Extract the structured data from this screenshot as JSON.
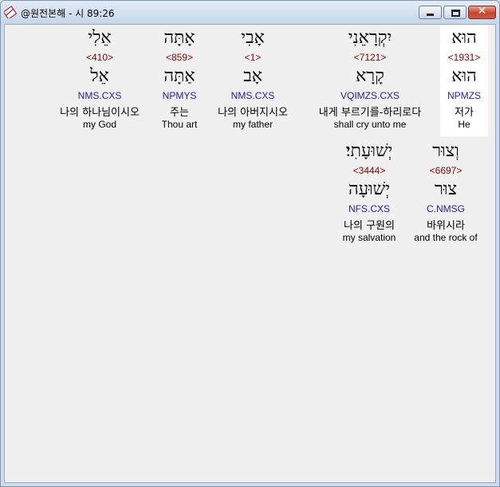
{
  "window": {
    "title": "@원전본해 - 시 89:26",
    "icon": "app-icon",
    "controls": {
      "minimize_icon": "minimize-icon",
      "maximize_icon": "maximize-icon",
      "close_icon": "close-icon"
    }
  },
  "line1": [
    {
      "hebrew": "הוּא",
      "strong": "<1931>",
      "lemma": "הוּא",
      "parsing": "NPMZS",
      "korean": "저가",
      "english": "He",
      "highlighted": true
    },
    {
      "hebrew": "יִקְרָאֵנִי",
      "strong": "<7121>",
      "lemma": "קָרָא",
      "parsing": "VQIMZS.CXS",
      "korean": "내게 부르기를-하리로다",
      "english": "shall cry unto me",
      "highlighted": false
    },
    {
      "hebrew": "אָבִי",
      "strong": "<1>",
      "lemma": "אָב",
      "parsing": "NMS.CXS",
      "korean": "나의 아버지시오",
      "english": "my father",
      "highlighted": false
    },
    {
      "hebrew": "אָתָּה",
      "strong": "<859>",
      "lemma": "אַתָּה",
      "parsing": "NPMYS",
      "korean": "주는",
      "english": "Thou art",
      "highlighted": false
    },
    {
      "hebrew": "אֵלִי",
      "strong": "<410>",
      "lemma": "אֵל",
      "parsing": "NMS.CXS",
      "korean": "나의 하나님이시오",
      "english": "my God",
      "highlighted": false
    }
  ],
  "line2": [
    {
      "hebrew": "וְצוּר",
      "strong": "<6697>",
      "lemma": "צוּר",
      "parsing": "C.NMSG",
      "korean": "바위시라",
      "english": "and the rock of",
      "highlighted": false
    },
    {
      "hebrew": "יְשׁוּעָתִי׃",
      "strong": "<3444>",
      "lemma": "יְשׁוּעָה",
      "parsing": "NFS.CXS",
      "korean": "나의 구원의",
      "english": "my salvation",
      "highlighted": false
    }
  ]
}
